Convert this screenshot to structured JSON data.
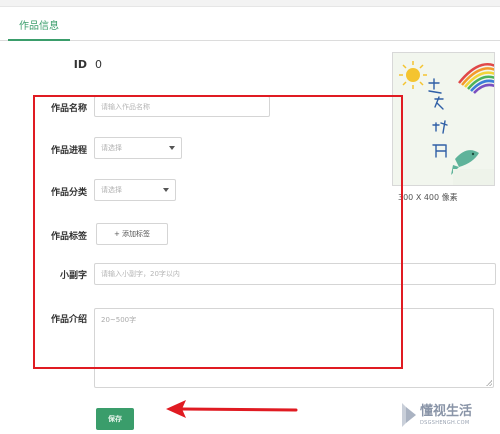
{
  "tabs": [
    {
      "label": "作品信息"
    }
  ],
  "form": {
    "id": {
      "label": "ID",
      "value": "0"
    },
    "name": {
      "label": "作品名称",
      "placeholder": "请输入作品名称"
    },
    "progress": {
      "label": "作品进程",
      "value": "请选择"
    },
    "category": {
      "label": "作品分类",
      "value": "请选择"
    },
    "tags": {
      "label": "作品标签",
      "button": "+ 添加标签"
    },
    "subtitle": {
      "label": "小副字",
      "placeholder": "请输入小副字，20字以内"
    },
    "intro": {
      "label": "作品介绍",
      "placeholder": "20~500字"
    },
    "save_label": "保存"
  },
  "cover": {
    "caption": "300 X 400 像素"
  },
  "watermark": {
    "text": "懂视生活",
    "sub": "DSGSHENGH.COM"
  },
  "colors": {
    "accent": "#3a9d6b",
    "annotation": "#e01b22"
  }
}
